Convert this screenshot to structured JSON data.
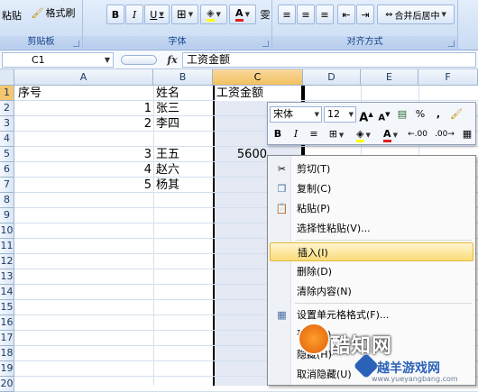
{
  "ribbon": {
    "paste_label": "粘贴",
    "format_painter_label": "格式刷",
    "clipboard_group": "剪贴板",
    "font_group": "字体",
    "align_group": "对齐方式",
    "bold": "B",
    "italic": "I",
    "underline": "U",
    "font_color_glyph": "A",
    "phonetic_glyph": "雯",
    "merge_center_label": "合并后居中"
  },
  "formula_bar": {
    "name_box": "C1",
    "fx": "fx",
    "content": "工资金额"
  },
  "grid": {
    "columns": [
      "A",
      "B",
      "C",
      "D",
      "E",
      "F"
    ],
    "rows": [
      "1",
      "2",
      "3",
      "4",
      "5",
      "6",
      "7",
      "8",
      "9",
      "10",
      "11",
      "12",
      "13",
      "14",
      "15",
      "16",
      "17",
      "18",
      "19",
      "20"
    ],
    "cells": {
      "a1": "序号",
      "b1": "姓名",
      "c1": "工资金额",
      "a2": "1",
      "b2": "张三",
      "a3": "2",
      "b3": "李四",
      "a5": "3",
      "b5": "王五",
      "a6": "4",
      "b6": "赵六",
      "a7": "5",
      "b7": "杨其",
      "c5": "5600"
    }
  },
  "mini_toolbar": {
    "font": "宋体",
    "size": "12",
    "grow": "A",
    "shrink": "A",
    "percent": "%",
    "comma": ",",
    "bold": "B",
    "italic": "I",
    "font_color": "A",
    "inc_decimal": ".00",
    "dec_decimal": ".00"
  },
  "context_menu": {
    "cut": "剪切(T)",
    "copy": "复制(C)",
    "paste": "粘贴(P)",
    "paste_special": "选择性粘贴(V)...",
    "insert": "插入(I)",
    "delete": "删除(D)",
    "clear": "清除内容(N)",
    "format_cells": "设置单元格格式(F)...",
    "col_width": "列宽(C)...",
    "hide": "隐藏(H)",
    "unhide": "取消隐藏(U)"
  },
  "watermarks": {
    "site1": "酷知网",
    "site2": "越羊游戏网",
    "site2_url": "www.yueyangbang.com"
  },
  "colors": {
    "selected_header": "#f1c15f",
    "menu_highlight": "#fbdb7a",
    "column_selection": "#e4e9f4"
  }
}
